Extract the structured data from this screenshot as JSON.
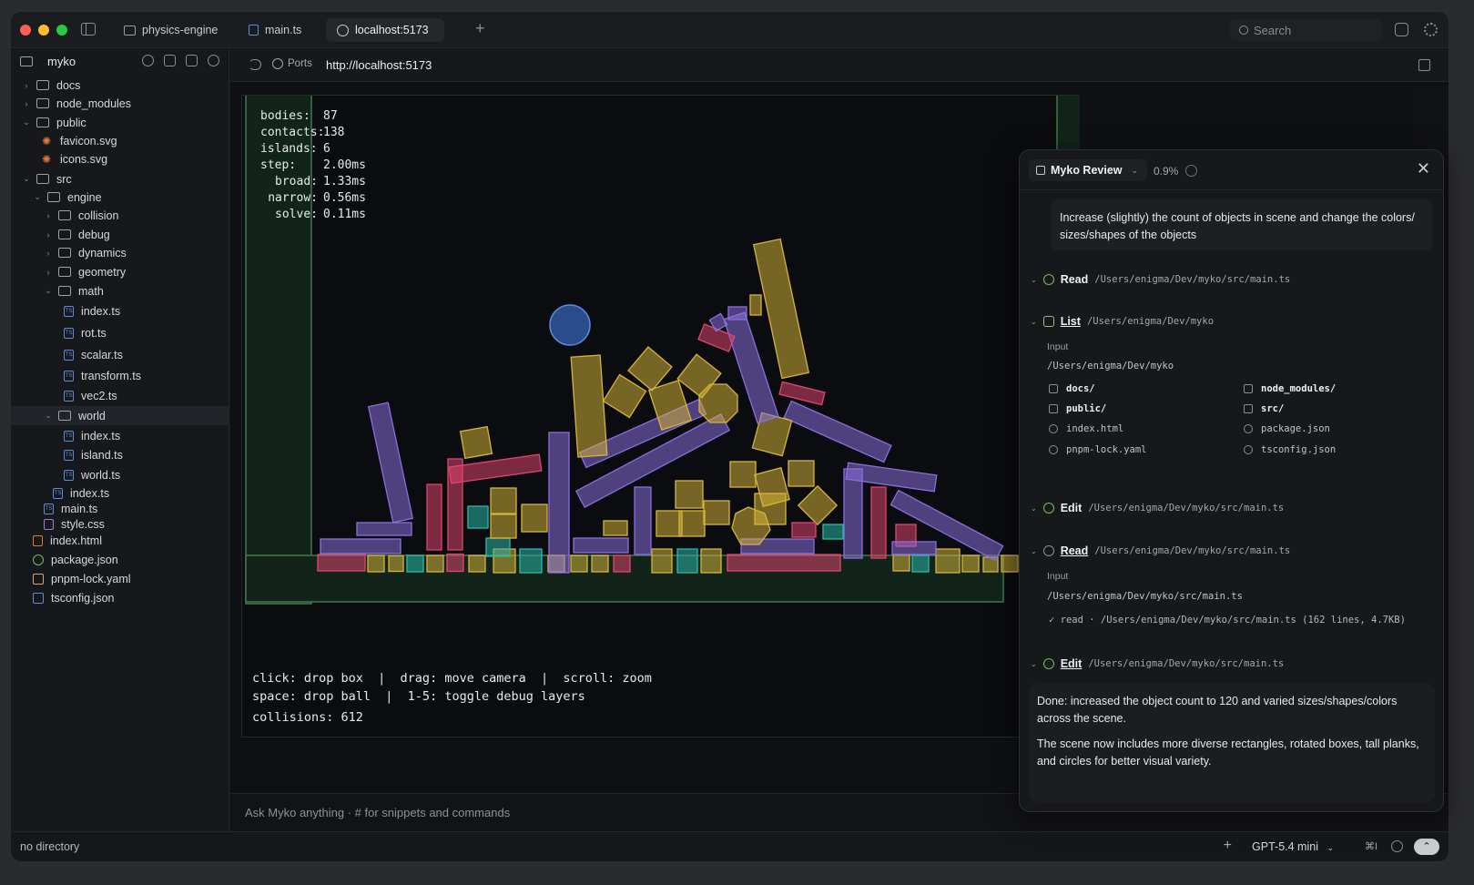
{
  "titlebar": {
    "tabs": [
      {
        "label": "physics-engine",
        "icon": "folder-icon"
      },
      {
        "label": "main.ts",
        "icon": "ts-file-icon"
      },
      {
        "label": "localhost:5173",
        "icon": "globe-icon"
      }
    ],
    "search_placeholder": "Search"
  },
  "sidebar": {
    "root": "myko",
    "items": [
      {
        "label": "docs",
        "kind": "folder",
        "chevron": "›"
      },
      {
        "label": "node_modules",
        "kind": "folder",
        "chevron": "›"
      },
      {
        "label": "public",
        "kind": "folder",
        "chevron": "⌄"
      },
      {
        "label": "favicon.svg",
        "kind": "svg"
      },
      {
        "label": "icons.svg",
        "kind": "svg"
      },
      {
        "label": "src",
        "kind": "folder",
        "chevron": "⌄"
      },
      {
        "label": "engine",
        "kind": "folder",
        "chevron": "⌄"
      },
      {
        "label": "collision",
        "kind": "folder",
        "chevron": "›"
      },
      {
        "label": "debug",
        "kind": "folder",
        "chevron": "›"
      },
      {
        "label": "dynamics",
        "kind": "folder",
        "chevron": "›"
      },
      {
        "label": "geometry",
        "kind": "folder",
        "chevron": "›"
      },
      {
        "label": "math",
        "kind": "folder",
        "chevron": "⌄"
      },
      {
        "label": "index.ts",
        "kind": "ts"
      },
      {
        "label": "rot.ts",
        "kind": "ts"
      },
      {
        "label": "scalar.ts",
        "kind": "ts"
      },
      {
        "label": "transform.ts",
        "kind": "ts"
      },
      {
        "label": "vec2.ts",
        "kind": "ts"
      },
      {
        "label": "world",
        "kind": "folder",
        "chevron": "⌄"
      },
      {
        "label": "index.ts",
        "kind": "ts"
      },
      {
        "label": "island.ts",
        "kind": "ts"
      },
      {
        "label": "world.ts",
        "kind": "ts"
      },
      {
        "label": "index.ts",
        "kind": "ts"
      },
      {
        "label": "main.ts",
        "kind": "ts"
      },
      {
        "label": "style.css",
        "kind": "css"
      },
      {
        "label": "index.html",
        "kind": "html"
      },
      {
        "label": "package.json",
        "kind": "pkg"
      },
      {
        "label": "pnpm-lock.yaml",
        "kind": "yaml"
      },
      {
        "label": "tsconfig.json",
        "kind": "json"
      }
    ]
  },
  "browser": {
    "ports_label": "Ports",
    "url": "http://localhost:5173",
    "hud": [
      {
        "key": "bodies:",
        "value": "87"
      },
      {
        "key": "contacts:",
        "value": "138"
      },
      {
        "key": "islands:",
        "value": "6"
      },
      {
        "key": "step:",
        "value": "2.00ms"
      },
      {
        "key": "broad:",
        "value": "1.33ms"
      },
      {
        "key": "narrow:",
        "value": "0.56ms"
      },
      {
        "key": "solve:",
        "value": "0.11ms"
      }
    ],
    "help_line_1": "click: drop box  |  drag: move camera  |  scroll: zoom",
    "help_line_2": "space: drop ball  |  1-5: toggle debug layers",
    "collisions": "collisions: 612",
    "ask_placeholder": "Ask Myko anything  ·  # for snippets and commands",
    "colors": {
      "wall": "#3f7a4a",
      "wall_fill": "#12241a",
      "yellow": "#d6b43a",
      "purple": "#8a6ee0",
      "pink": "#e0456e",
      "teal": "#2ab8a8",
      "blue": "#3a6cc8"
    }
  },
  "review": {
    "title": "Myko Review",
    "percent": "0.9%",
    "prompt": "Increase (slightly) the count of objects in scene and change the colors/ sizes/shapes of the objects",
    "steps": [
      {
        "verb": "Read",
        "path": "/Users/enigma/Dev/myko/src/main.ts"
      },
      {
        "verb": "List",
        "path": "/Users/enigma/Dev/myko"
      },
      {
        "verb": "Edit",
        "path": "/Users/enigma/Dev/myko/src/main.ts"
      },
      {
        "verb": "Read",
        "path": "/Users/enigma/Dev/myko/src/main.ts"
      },
      {
        "verb": "Edit",
        "path": "/Users/enigma/Dev/myko/src/main.ts"
      }
    ],
    "list_input_label": "Input",
    "list_input": "/Users/enigma/Dev/myko",
    "list_items": [
      {
        "name": "docs/",
        "dir": true
      },
      {
        "name": "node_modules/",
        "dir": true
      },
      {
        "name": "public/",
        "dir": true
      },
      {
        "name": "src/",
        "dir": true
      },
      {
        "name": "index.html",
        "dir": false
      },
      {
        "name": "package.json",
        "dir": false
      },
      {
        "name": "pnpm-lock.yaml",
        "dir": false
      },
      {
        "name": "tsconfig.json",
        "dir": false
      }
    ],
    "read_input_label": "Input",
    "read_input": "/Users/enigma/Dev/myko/src/main.ts",
    "read_result": "✓ read · /Users/enigma/Dev/myko/src/main.ts (162 lines, 4.7KB)",
    "done_1": "Done: increased the object count to 120 and varied sizes/shapes/colors across the scene.",
    "done_2": "The scene now includes more diverse rectangles, rotated boxes, tall planks, and circles for better visual variety."
  },
  "status": {
    "directory": "no directory",
    "model": "GPT-5.4 mini",
    "shortcut": "⌘I"
  }
}
